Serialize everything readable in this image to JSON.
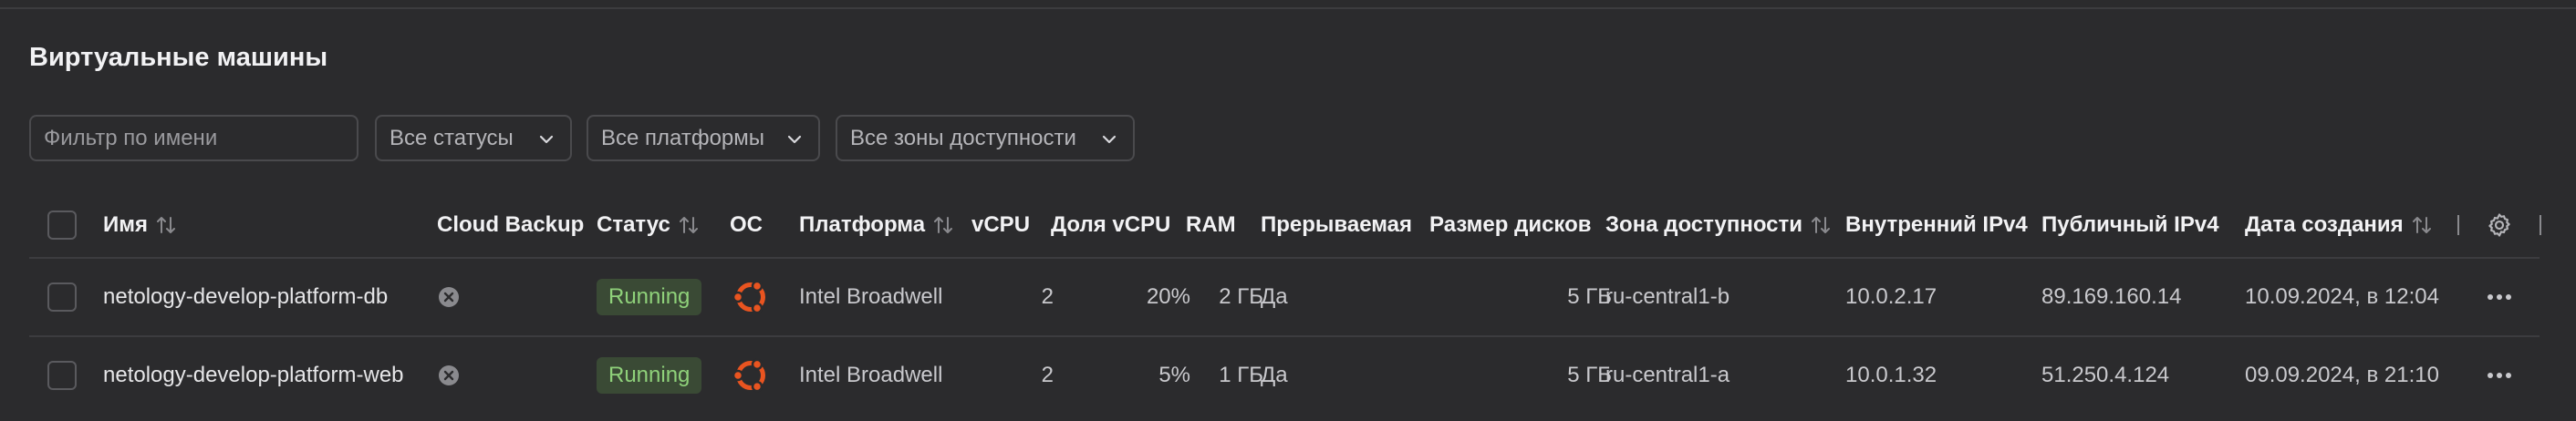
{
  "page": {
    "title": "Виртуальные машины"
  },
  "filters": {
    "name_placeholder": "Фильтр по имени",
    "status": "Все статусы",
    "platform": "Все платформы",
    "zone": "Все зоны доступности"
  },
  "table": {
    "headers": {
      "name": "Имя",
      "backup": "Cloud Backup",
      "status": "Статус",
      "os": "ОС",
      "platform": "Платформа",
      "vcpu": "vCPU",
      "vcpu_share": "Доля vCPU",
      "ram": "RAM",
      "preemptible": "Прерываемая",
      "disk": "Размер дисков",
      "zone": "Зона доступности",
      "ipv4_internal": "Внутренний IPv4",
      "ipv4_public": "Публичный IPv4",
      "created": "Дата создания"
    },
    "rows": [
      {
        "name": "netology-develop-platform-db",
        "status": "Running",
        "os_icon": "ubuntu-icon",
        "platform": "Intel Broadwell",
        "vcpu": "2",
        "vcpu_share": "20%",
        "ram": "2 ГБ",
        "preemptible": "Да",
        "disk": "5 ГБ",
        "zone": "ru-central1-b",
        "ipv4_internal": "10.0.2.17",
        "ipv4_public": "89.169.160.14",
        "created": "10.09.2024, в 12:04"
      },
      {
        "name": "netology-develop-platform-web",
        "status": "Running",
        "os_icon": "ubuntu-icon",
        "platform": "Intel Broadwell",
        "vcpu": "2",
        "vcpu_share": "5%",
        "ram": "1 ГБ",
        "preemptible": "Да",
        "disk": "5 ГБ",
        "zone": "ru-central1-a",
        "ipv4_internal": "10.0.1.32",
        "ipv4_public": "51.250.4.124",
        "created": "09.09.2024, в 21:10"
      }
    ]
  },
  "colors": {
    "background": "#2b2b2d",
    "status_running_bg": "#3a4a35",
    "status_running_text": "#8fd17a",
    "ubuntu_orange": "#e95420"
  }
}
